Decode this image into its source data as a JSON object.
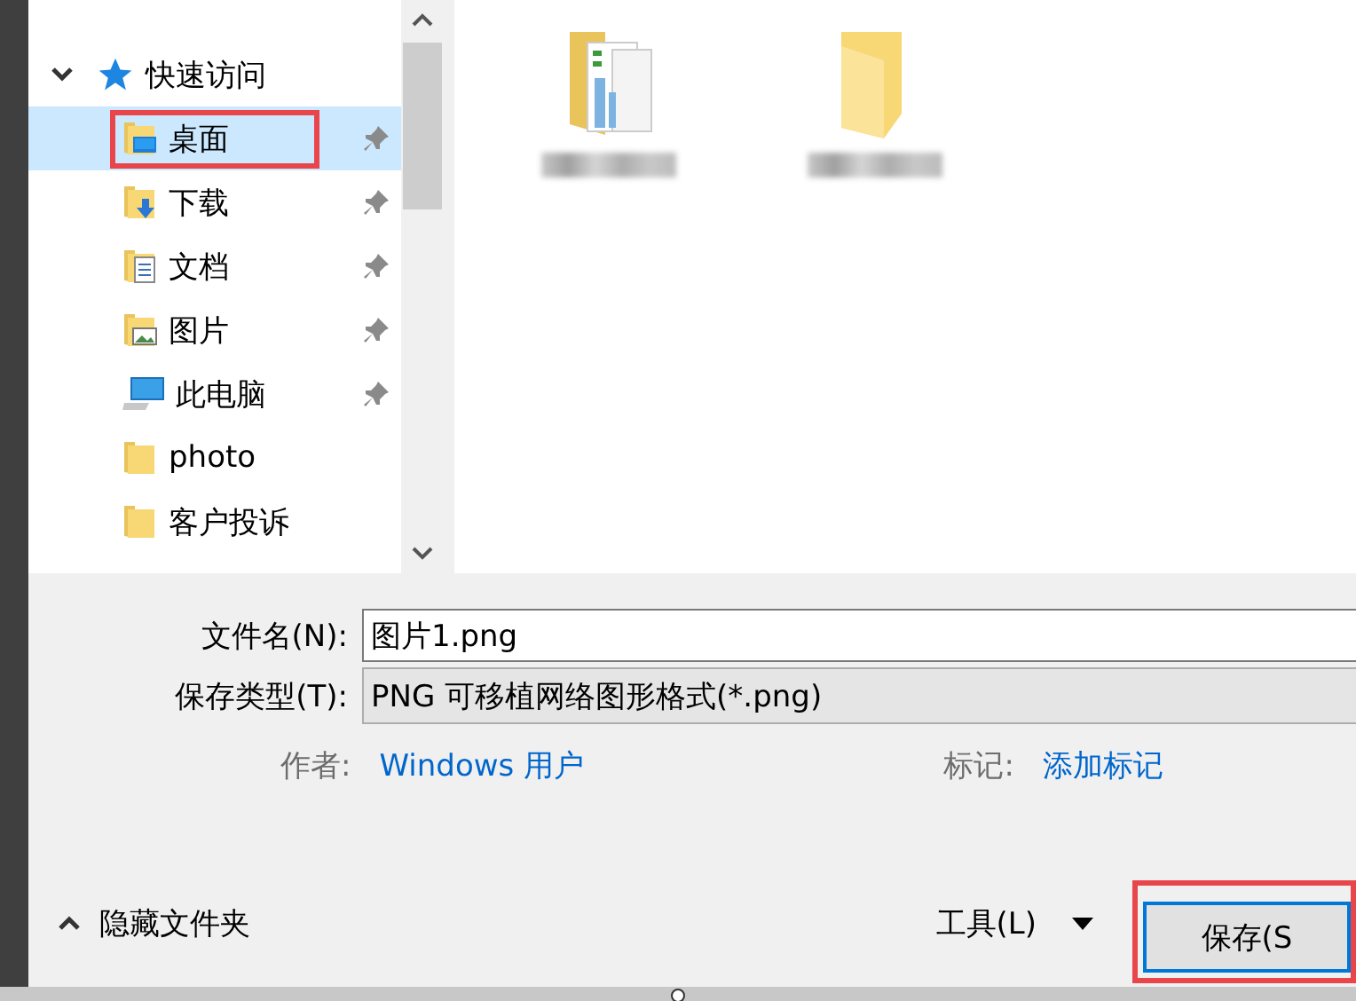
{
  "navigation": {
    "root": {
      "label": "快速访问",
      "expanded": true
    },
    "items": [
      {
        "label": "桌面",
        "kind": "desktop",
        "pinned": true,
        "selected": true,
        "highlighted": true
      },
      {
        "label": "下载",
        "kind": "download",
        "pinned": true,
        "selected": false,
        "highlighted": false
      },
      {
        "label": "文档",
        "kind": "document",
        "pinned": true,
        "selected": false,
        "highlighted": false
      },
      {
        "label": "图片",
        "kind": "picture",
        "pinned": true,
        "selected": false,
        "highlighted": false
      },
      {
        "label": "此电脑",
        "kind": "computer",
        "pinned": true,
        "selected": false,
        "highlighted": false
      },
      {
        "label": "photo",
        "kind": "folder",
        "pinned": false,
        "selected": false,
        "highlighted": false
      },
      {
        "label": "客户投诉",
        "kind": "folder",
        "pinned": false,
        "selected": false,
        "highlighted": false
      }
    ]
  },
  "files": [
    {
      "kind": "documents"
    },
    {
      "kind": "empty"
    }
  ],
  "form": {
    "filename": {
      "label": "文件名(N):",
      "value": "图片1.png"
    },
    "filetype": {
      "label": "保存类型(T):",
      "value": "PNG 可移植网络图形格式(*.png)"
    },
    "author": {
      "label": "作者:",
      "value": "Windows 用户"
    },
    "tags": {
      "label": "标记:",
      "value": "添加标记"
    }
  },
  "footer": {
    "hide_folders": "隐藏文件夹",
    "tools": "工具(L)",
    "save": {
      "label": "保存(S",
      "highlighted": true
    }
  }
}
